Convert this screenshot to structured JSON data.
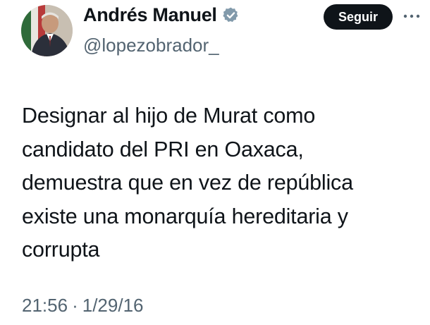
{
  "author": {
    "display_name": "Andrés Manuel",
    "handle": "@lopezobrador_",
    "verified_icon": "verified-badge-icon",
    "avatar": "avatar-photo"
  },
  "actions": {
    "follow_label": "Seguir",
    "more_icon": "more-options-icon"
  },
  "tweet": {
    "lines": [
      "Designar al hijo de Murat como",
      "candidato del PRI en Oaxaca,",
      "demuestra que en vez de república",
      "existe una monarquía hereditaria y",
      "corrupta"
    ],
    "time": "21:56",
    "separator": "·",
    "date": "1/29/16"
  },
  "colors": {
    "text": "#0f1419",
    "secondary": "#536471",
    "button_bg": "#0f1419",
    "verified": "#829aab"
  }
}
